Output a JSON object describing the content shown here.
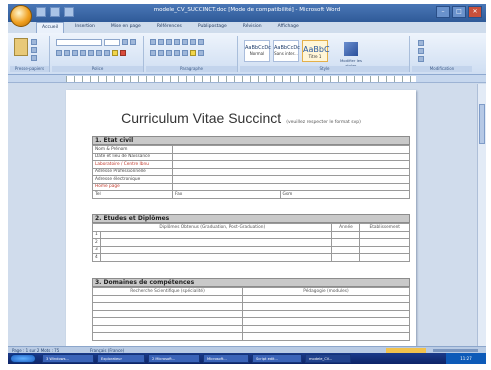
{
  "window": {
    "title": "modele_CV_SUCCINCT.doc [Mode de compatibilité] - Microsoft Word"
  },
  "ribbon": {
    "tabs": [
      "Accueil",
      "Insertion",
      "Mise en page",
      "Références",
      "Publipostage",
      "Révision",
      "Affichage"
    ],
    "groups": [
      "Presse-papiers",
      "Police",
      "Paragraphe",
      "Style",
      "Modification"
    ],
    "styles": [
      {
        "sample": "AaBbCcDc",
        "label": "Normal"
      },
      {
        "sample": "AaBbCcDc",
        "label": "Sans inter..."
      },
      {
        "sample": "AaBbC",
        "label": "Titre 1"
      }
    ],
    "change_styles_label": "Modifier les styles"
  },
  "document": {
    "title": "Curriculum Vitae Succinct",
    "subtitle": "(veuillez respecter le format svp)",
    "section1": {
      "heading": "1. Etat civil",
      "rows": [
        "Nom & Prénom",
        "Date et lieu de Naissance",
        "Laboratoire / Centre  Ibnu",
        "Adresse Professionnelle",
        "Adresse électronique",
        "Home page"
      ],
      "contact_labels": [
        "Tel",
        "Fax",
        "Gsm"
      ]
    },
    "section2": {
      "heading": "2. Etudes et Diplômes",
      "columns": [
        "Diplômes Obtenus (Graduation, Post-Graduation)",
        "Année",
        "Etablissement"
      ],
      "rows": [
        "1",
        "2",
        "3",
        "4"
      ]
    },
    "section3": {
      "heading": "3. Domaines de compétences",
      "columns": [
        "Recherche Scientifique (spécialité)",
        "Pédagogie (modules)"
      ],
      "row_count": 6
    }
  },
  "statusbar": {
    "text": "Page : 1 sur 2   Mots : 75",
    "language": "Français (France)"
  },
  "taskbar": {
    "items": [
      "3 Windows...",
      "Explorateur",
      "2 Microsoft...",
      "Microsoft...",
      "Script edit...",
      "modele_CV..."
    ],
    "clock": "11:27"
  }
}
